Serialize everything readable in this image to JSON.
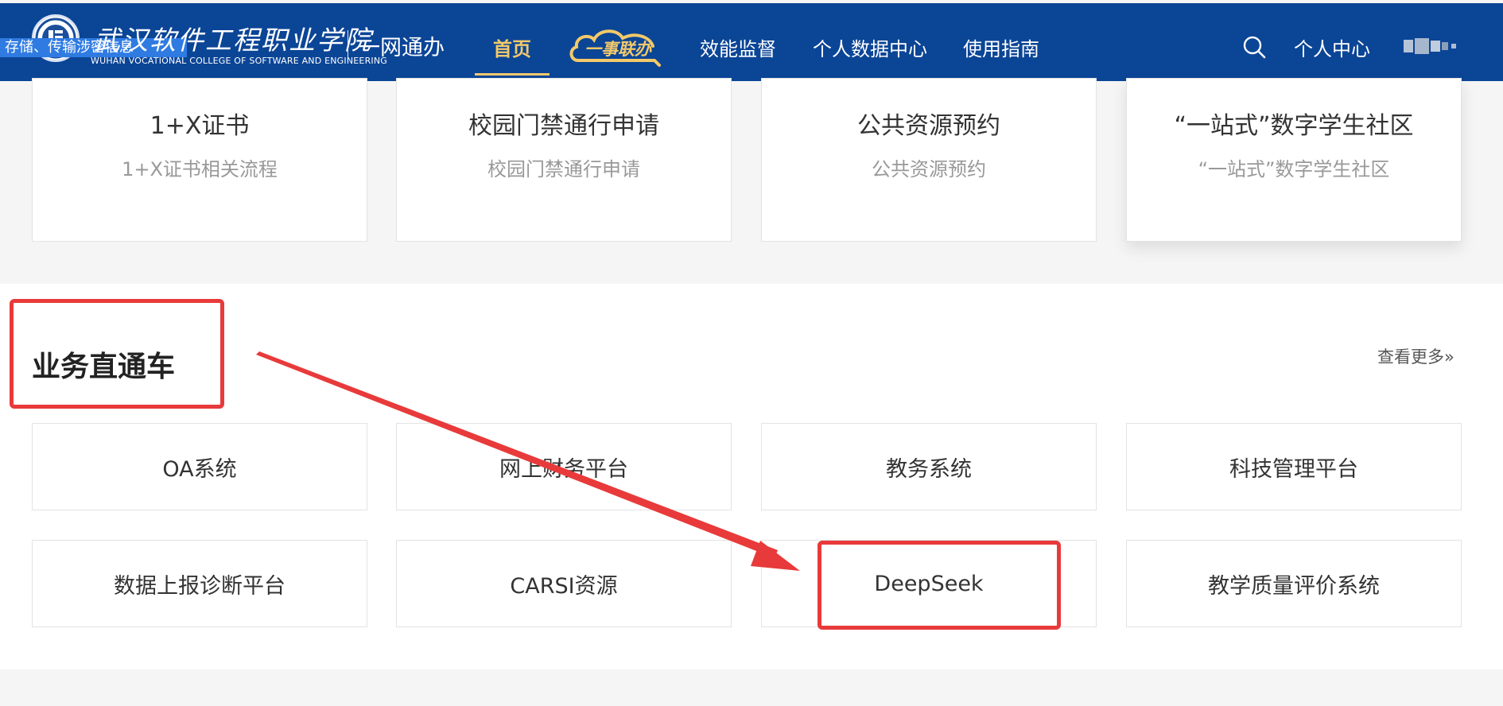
{
  "header": {
    "banner_text": "存储、传输涉密信息",
    "school_name_cn": "武汉软件工程职业学院",
    "school_name_en": "WUHAN VOCATIONAL COLLEGE OF SOFTWARE AND ENGINEERING",
    "portal_name": "一网通办",
    "nav": {
      "home": "首页",
      "yishi": "一事联办",
      "efficiency": "效能监督",
      "personal_data": "个人数据中心",
      "guide": "使用指南"
    },
    "personal_center": "个人中心",
    "colors": {
      "bar": "#0b4596",
      "active": "#f3c96a"
    }
  },
  "top_cards": [
    {
      "title": "1+X证书",
      "subtitle": "1+X证书相关流程"
    },
    {
      "title": "校园门禁通行申请",
      "subtitle": "校园门禁通行申请"
    },
    {
      "title": "公共资源预约",
      "subtitle": "公共资源预约"
    },
    {
      "title": "“一站式”数字学生社区",
      "subtitle": "“一站式”数字学生社区"
    }
  ],
  "business": {
    "title": "业务直通车",
    "more": "查看更多»",
    "items": [
      "OA系统",
      "网上财务平台",
      "教务系统",
      "科技管理平台",
      "数据上报诊断平台",
      "CARSI资源",
      "DeepSeek",
      "教学质量评价系统"
    ]
  },
  "annotation": {
    "color": "#e83a3a"
  }
}
